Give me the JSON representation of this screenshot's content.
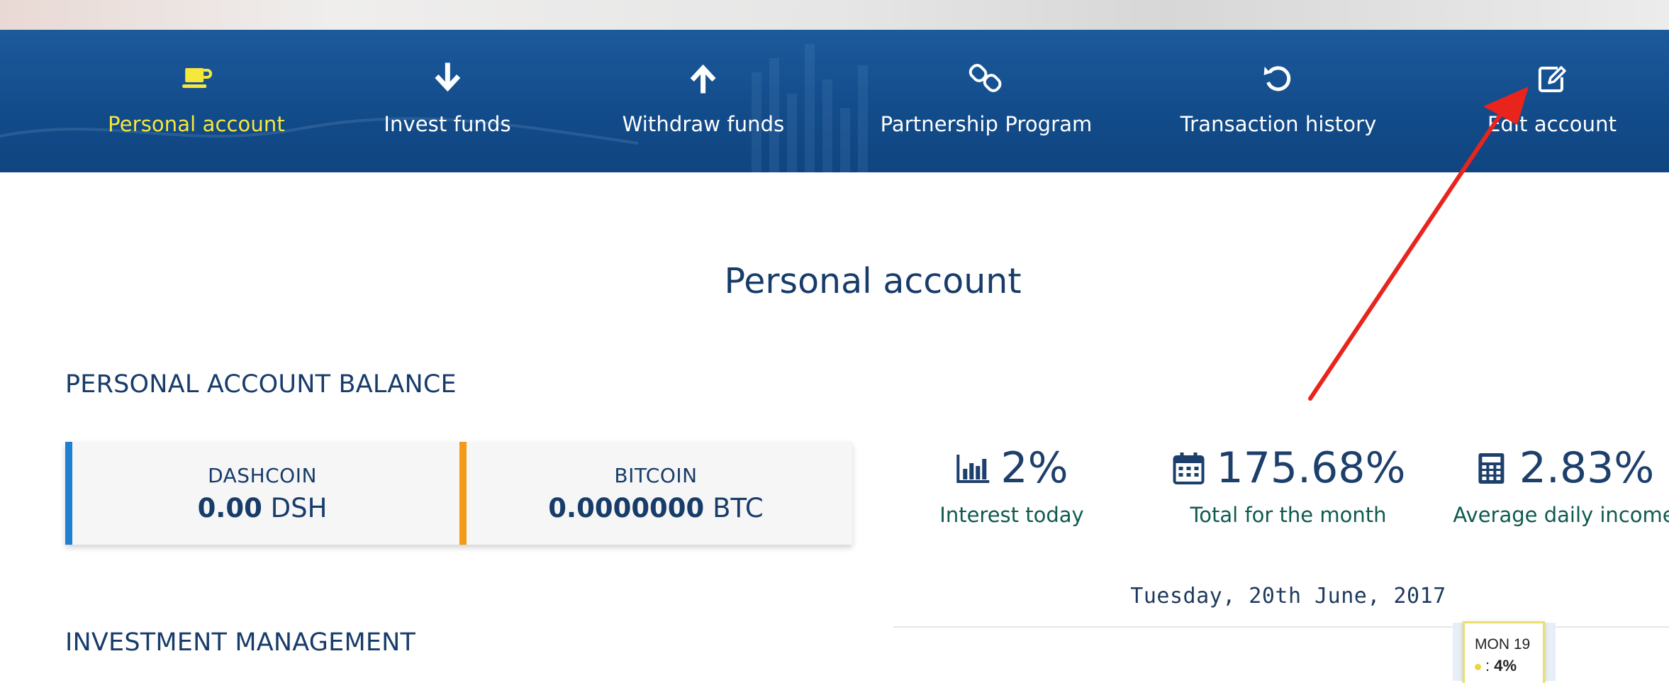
{
  "nav": {
    "items": [
      {
        "label": "Personal account",
        "icon": "cup-icon",
        "active": true
      },
      {
        "label": "Invest funds",
        "icon": "arrow-down-icon",
        "active": false
      },
      {
        "label": "Withdraw funds",
        "icon": "arrow-up-icon",
        "active": false
      },
      {
        "label": "Partnership Program",
        "icon": "link-icon",
        "active": false
      },
      {
        "label": "Transaction history",
        "icon": "history-icon",
        "active": false
      },
      {
        "label": "Edit account",
        "icon": "edit-icon",
        "active": false
      }
    ],
    "active_color": "#f6e73b",
    "background_color": "#134c8b"
  },
  "page": {
    "title": "Personal account"
  },
  "balance": {
    "heading": "PERSONAL ACCOUNT BALANCE",
    "coins": [
      {
        "name": "DASHCOIN",
        "amount": "0.00",
        "unit": "DSH",
        "accent": "#1f7fd0"
      },
      {
        "name": "BITCOIN",
        "amount": "0.0000000",
        "unit": "BTC",
        "accent": "#f39a1b"
      }
    ]
  },
  "stats": [
    {
      "icon": "bar-chart-icon",
      "value": "2%",
      "caption": "Interest today"
    },
    {
      "icon": "calendar-icon",
      "value": "175.68%",
      "caption": "Total for the month"
    },
    {
      "icon": "calculator-icon",
      "value": "2.83%",
      "caption": "Average daily income"
    }
  ],
  "investment": {
    "heading": "INVESTMENT MANAGEMENT"
  },
  "chart": {
    "date": "Tuesday, 20th June, 2017",
    "tooltip": {
      "day": "MON 19",
      "value": "4%"
    }
  },
  "annotation": {
    "arrow_color": "#e8241d"
  }
}
